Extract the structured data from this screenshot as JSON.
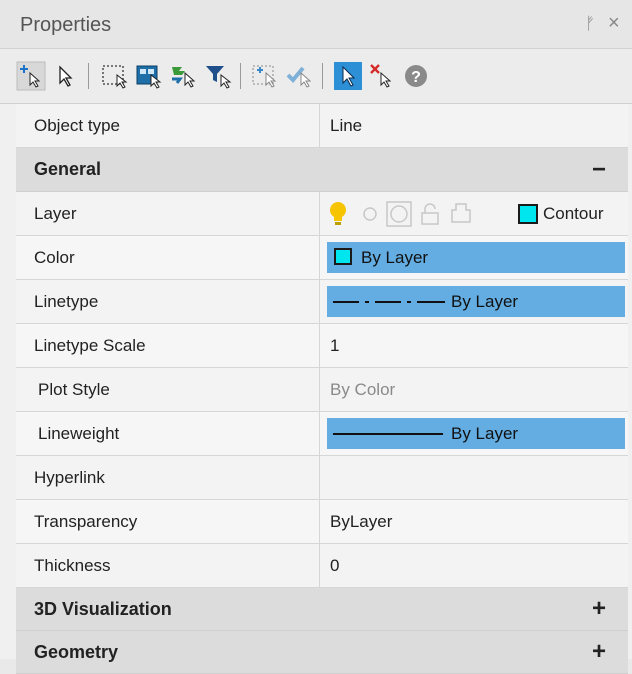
{
  "window": {
    "title": "Properties",
    "pin_glyph": "ᚠ",
    "close_glyph": "×"
  },
  "toolbar": {
    "icons": [
      "add-selection-icon",
      "select-pointer-icon",
      "window-select-icon",
      "crossing-select-icon",
      "select-all-icon",
      "filter-select-icon",
      "pickadd-icon",
      "quick-select-icon",
      "active-select-icon",
      "deselect-icon",
      "help-icon"
    ],
    "help_glyph": "?"
  },
  "grid": {
    "object_type": {
      "label": "Object type",
      "value": "Line"
    },
    "sections": [
      {
        "name": "General",
        "toggle": "−",
        "rows": [
          {
            "label": "Layer",
            "value": "Contour",
            "swatch_color": "#00e6ee"
          },
          {
            "label": "Color",
            "value": "By Layer",
            "swatch_color": "#00e6ee"
          },
          {
            "label": "Linetype",
            "value": "By Layer"
          },
          {
            "label": "Linetype Scale",
            "value": "1"
          },
          {
            "label": "Plot Style",
            "value": "By Color"
          },
          {
            "label": "Lineweight",
            "value": "By Layer"
          },
          {
            "label": "Hyperlink",
            "value": ""
          },
          {
            "label": "Transparency",
            "value": "ByLayer"
          },
          {
            "label": "Thickness",
            "value": "0"
          }
        ]
      },
      {
        "name": "3D Visualization",
        "toggle": "+"
      },
      {
        "name": "Geometry",
        "toggle": "+"
      }
    ]
  },
  "colors": {
    "highlight": "#63ade3",
    "section_bg": "#dcdcdc",
    "bulb": "#f6c400"
  }
}
